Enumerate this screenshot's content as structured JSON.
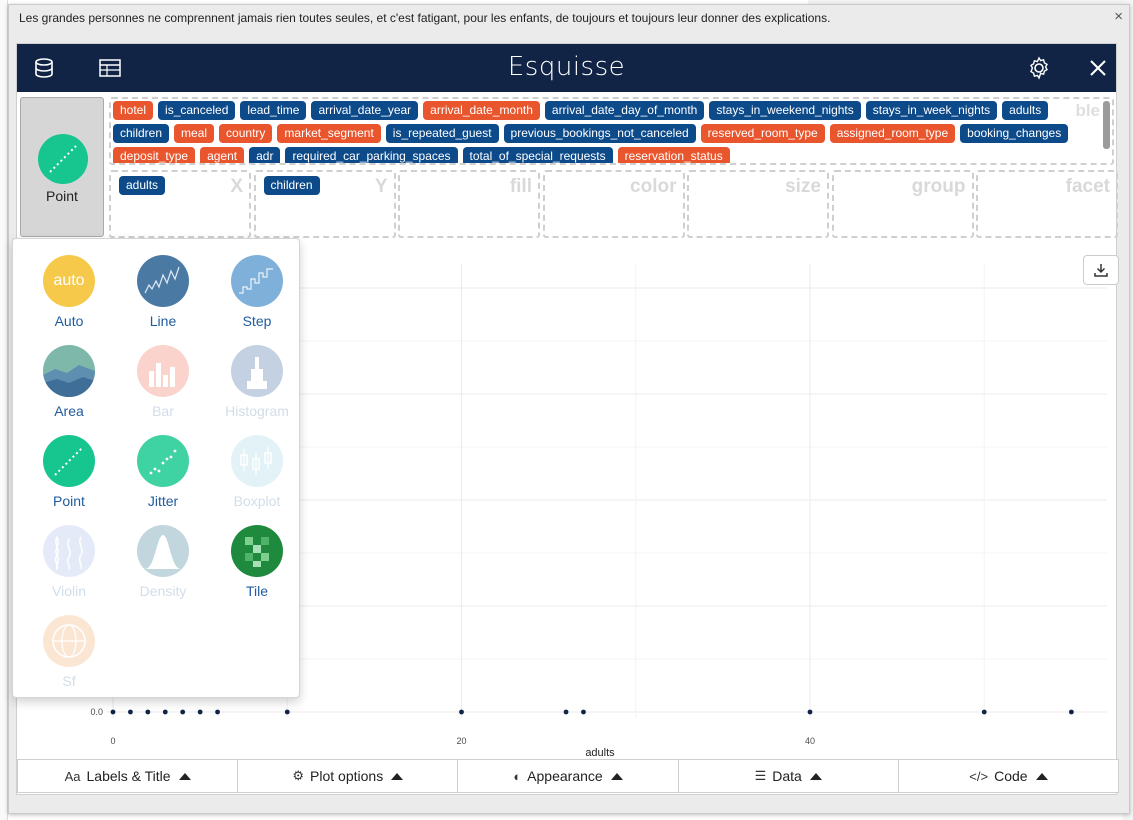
{
  "viewer": {
    "title": "Les grandes personnes ne comprennent jamais rien toutes seules, et c'est fatigant, pour les enfants, de toujours et toujours leur donner des explications.",
    "close_symbol": "×"
  },
  "header": {
    "title": "Esquisse",
    "icons": [
      "database-icon",
      "table-icon",
      "gear-icon",
      "close-icon"
    ]
  },
  "geom_button": {
    "label": "Point",
    "icon": "point-icon"
  },
  "variables": [
    {
      "name": "hotel",
      "type": "cat"
    },
    {
      "name": "is_canceled",
      "type": "num"
    },
    {
      "name": "lead_time",
      "type": "num"
    },
    {
      "name": "arrival_date_year",
      "type": "num"
    },
    {
      "name": "arrival_date_month",
      "type": "cat"
    },
    {
      "name": "arrival_date_day_of_month",
      "type": "num"
    },
    {
      "name": "stays_in_weekend_nights",
      "type": "num"
    },
    {
      "name": "stays_in_week_nights",
      "type": "num"
    },
    {
      "name": "adults",
      "type": "num"
    },
    {
      "name": "children",
      "type": "num"
    },
    {
      "name": "meal",
      "type": "cat"
    },
    {
      "name": "country",
      "type": "cat"
    },
    {
      "name": "market_segment",
      "type": "cat"
    },
    {
      "name": "is_repeated_guest",
      "type": "num"
    },
    {
      "name": "previous_bookings_not_canceled",
      "type": "num"
    },
    {
      "name": "reserved_room_type",
      "type": "cat"
    },
    {
      "name": "assigned_room_type",
      "type": "cat"
    },
    {
      "name": "booking_changes",
      "type": "num"
    },
    {
      "name": "deposit_type",
      "type": "cat"
    },
    {
      "name": "agent",
      "type": "cat"
    },
    {
      "name": "adr",
      "type": "num"
    },
    {
      "name": "required_car_parking_spaces",
      "type": "num"
    },
    {
      "name": "total_of_special_requests",
      "type": "num"
    },
    {
      "name": "reservation_status",
      "type": "cat"
    }
  ],
  "pool_ghost_label": "ble",
  "zones": [
    {
      "label": "X",
      "value": "adults"
    },
    {
      "label": "Y",
      "value": "children"
    },
    {
      "label": "fill",
      "value": ""
    },
    {
      "label": "color",
      "value": ""
    },
    {
      "label": "size",
      "value": ""
    },
    {
      "label": "group",
      "value": ""
    },
    {
      "label": "facet",
      "value": ""
    }
  ],
  "geom_menu": [
    {
      "label": "Auto",
      "enabled": true,
      "icon": "auto-icon"
    },
    {
      "label": "Line",
      "enabled": true,
      "icon": "line-chart-icon"
    },
    {
      "label": "Step",
      "enabled": true,
      "icon": "step-chart-icon"
    },
    {
      "label": "Area",
      "enabled": true,
      "icon": "area-chart-icon"
    },
    {
      "label": "Bar",
      "enabled": false,
      "icon": "bar-chart-icon"
    },
    {
      "label": "Histogram",
      "enabled": false,
      "icon": "histogram-icon"
    },
    {
      "label": "Point",
      "enabled": true,
      "icon": "point-icon"
    },
    {
      "label": "Jitter",
      "enabled": true,
      "icon": "jitter-icon"
    },
    {
      "label": "Boxplot",
      "enabled": false,
      "icon": "boxplot-icon"
    },
    {
      "label": "Violin",
      "enabled": false,
      "icon": "violin-icon"
    },
    {
      "label": "Density",
      "enabled": false,
      "icon": "density-icon"
    },
    {
      "label": "Tile",
      "enabled": true,
      "icon": "tile-icon"
    },
    {
      "label": "Sf",
      "enabled": false,
      "icon": "globe-icon"
    }
  ],
  "auto_icon_text": "auto",
  "chart_data": {
    "type": "scatter",
    "xlabel": "adults",
    "ylabel": "",
    "x_ticks": [
      "0",
      "20",
      "40"
    ],
    "y_ticks": [
      "0.0"
    ],
    "xlim": [
      0,
      55
    ],
    "ylim": [
      0,
      10
    ],
    "points": [
      {
        "x": 0,
        "y": 0
      },
      {
        "x": 1,
        "y": 0
      },
      {
        "x": 2,
        "y": 0
      },
      {
        "x": 3,
        "y": 0
      },
      {
        "x": 4,
        "y": 0
      },
      {
        "x": 5,
        "y": 0
      },
      {
        "x": 6,
        "y": 0
      },
      {
        "x": 10,
        "y": 0
      },
      {
        "x": 20,
        "y": 0
      },
      {
        "x": 26,
        "y": 0
      },
      {
        "x": 27,
        "y": 0
      },
      {
        "x": 40,
        "y": 0
      },
      {
        "x": 50,
        "y": 0
      },
      {
        "x": 55,
        "y": 0
      }
    ]
  },
  "bottom_buttons": [
    {
      "label": "Labels & Title",
      "icon": "Aa"
    },
    {
      "label": "Plot options",
      "icon": "⚙"
    },
    {
      "label": "Appearance",
      "icon": "◐"
    },
    {
      "label": "Data",
      "icon": "☰"
    },
    {
      "label": "Code",
      "icon": "</>"
    }
  ],
  "colors": {
    "header": "#112446",
    "categorical": "#e9562e",
    "numeric": "#0d4a8a",
    "point": "#17c58f",
    "link": "#1f5b9e",
    "dot": "#112446"
  }
}
